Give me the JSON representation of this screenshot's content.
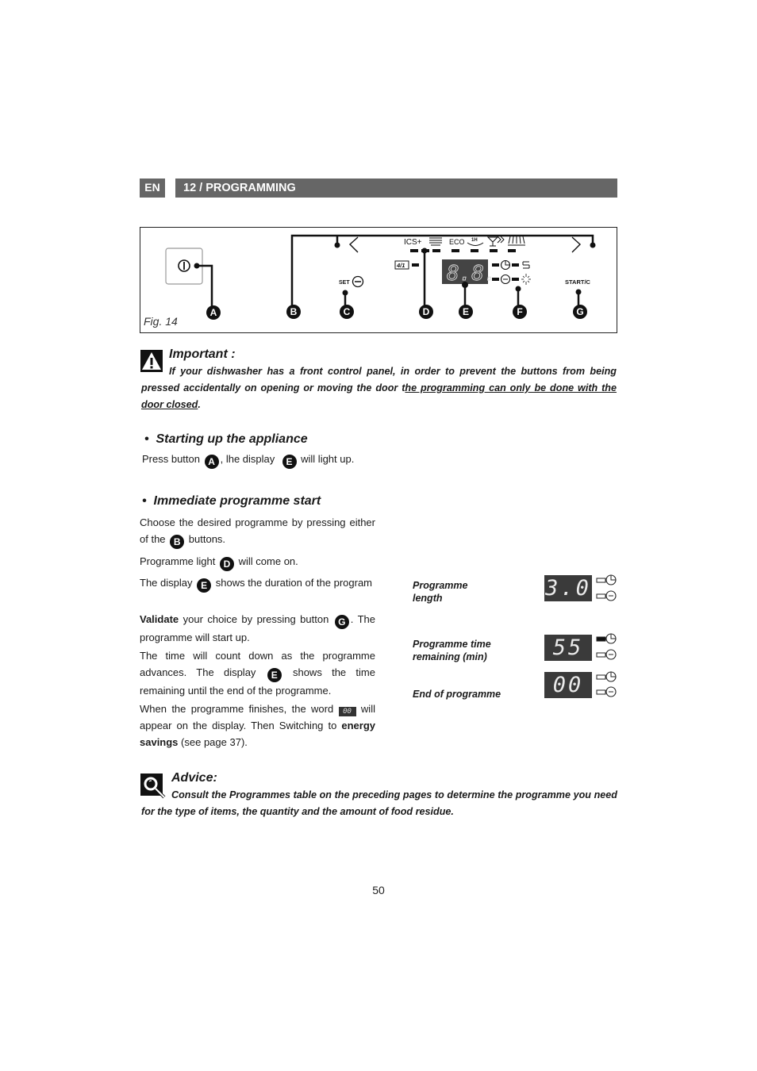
{
  "header": {
    "language": "EN",
    "section_title": "12 / PROGRAMMING"
  },
  "figure": {
    "caption": "Fig. 14",
    "callouts": [
      "A",
      "B",
      "C",
      "D",
      "E",
      "F",
      "G"
    ],
    "panel": {
      "set_label": "SET",
      "start_label": "START/C",
      "programme_icons": [
        "ICS+",
        "intensive-icon",
        "ECO",
        "1H",
        "glass-icon",
        "prewash-icon"
      ],
      "half_load_label": "4/1",
      "display_value": "8.8."
    }
  },
  "important": {
    "title": "Important :",
    "text_plain": "If your dishwasher has a front control panel, in order to prevent the buttons from being pressed accidentally on opening or moving the door t",
    "text_underlined": "he programming can only be done with the door closed",
    "text_end": "."
  },
  "starting": {
    "heading": "Starting up the appliance",
    "p1_a": "Press button",
    "p1_badge_a": "A",
    "p1_b": ", lhe display",
    "p1_badge_b": "E",
    "p1_c": "will light up."
  },
  "immediate": {
    "heading": "Immediate programme start",
    "p1_a": "Choose the desired programme by pressing either of the",
    "p1_badge": "B",
    "p1_b": "buttons.",
    "p2_a": "Programme light",
    "p2_badge": "D",
    "p2_b": "will come on.",
    "p3_a": "The display",
    "p3_badge": "E",
    "p3_b": "shows the duration of the program",
    "p4_bold": "Validate",
    "p4_a": "your choice by pressing button",
    "p4_badge": "G",
    "p4_b": ". The programme will start up.",
    "p5_a": "The time will count down as the programme advances. The display",
    "p5_badge": "E",
    "p5_b": "shows the time remaining until the end of the programme.",
    "p6_a": "When the programme finishes, the word",
    "p6_lcd": "00",
    "p6_b": "will appear on the display. Then Switching to",
    "p6_bold": "energy savings",
    "p6_c": "(see page 37)."
  },
  "displays": [
    {
      "label_line1": "Programme",
      "label_line2": "length",
      "value": "3.0",
      "clock_active": false
    },
    {
      "label_line1": "Programme time",
      "label_line2": "remaining (min)",
      "value": "55",
      "clock_active": true
    },
    {
      "label_line1": "End of programme",
      "label_line2": "",
      "value": "00",
      "clock_active": false
    }
  ],
  "advice": {
    "title": "Advice:",
    "text": "Consult the Programmes table on the preceding pages to determine the programme you need for the type of items, the quantity and the amount of food residue."
  },
  "page_number": "50"
}
